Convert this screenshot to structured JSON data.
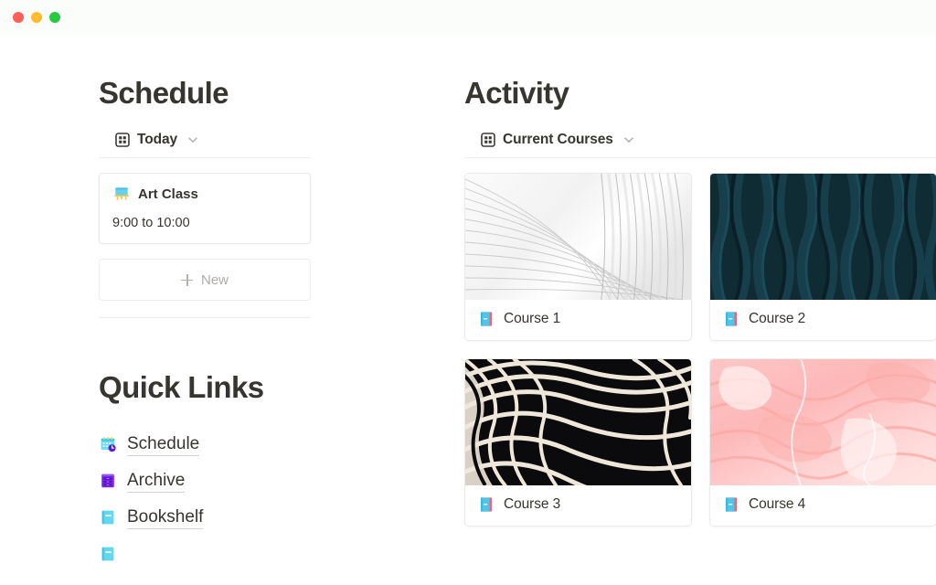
{
  "window": {
    "traffic_lights": [
      {
        "name": "close",
        "color": "#ff5f57"
      },
      {
        "name": "minimize",
        "color": "#febc2e"
      },
      {
        "name": "zoom",
        "color": "#28c840"
      }
    ],
    "titlebar_color": "#fbfdfa"
  },
  "schedule": {
    "title": "Schedule",
    "view": {
      "label": "Today",
      "icon": "table-grid-icon",
      "chevron": "chevron-down-icon"
    },
    "events": [
      {
        "icon": "artist-easel-emoji",
        "title": "Art Class",
        "time": "9:00 to 10:00"
      }
    ],
    "new_button": {
      "label": "New",
      "icon": "plus-icon"
    }
  },
  "quick_links": {
    "title": "Quick Links",
    "items": [
      {
        "label": "Schedule",
        "icon": "calendar-clock-emoji"
      },
      {
        "label": "Archive",
        "icon": "file-cabinet-emoji"
      },
      {
        "label": "Bookshelf",
        "icon": "blue-book-emoji"
      },
      {
        "label": "",
        "icon": "blue-book-emoji"
      }
    ]
  },
  "activity": {
    "title": "Activity",
    "view": {
      "label": "Current Courses",
      "icon": "table-grid-icon",
      "chevron": "chevron-down-icon"
    },
    "courses": [
      {
        "name": "Course 1",
        "icon": "notebook-emoji",
        "cover": "white-pleated-fan"
      },
      {
        "name": "Course 2",
        "icon": "notebook-emoji",
        "cover": "dark-teal-waves"
      },
      {
        "name": "Course 3",
        "icon": "notebook-emoji",
        "cover": "black-cream-swirls"
      },
      {
        "name": "Course 4",
        "icon": "pink-marble"
      }
    ]
  },
  "colors": {
    "text": "#37352f",
    "muted": "#aeaca8",
    "border": "#ebebea",
    "divider": "#ececeb"
  }
}
